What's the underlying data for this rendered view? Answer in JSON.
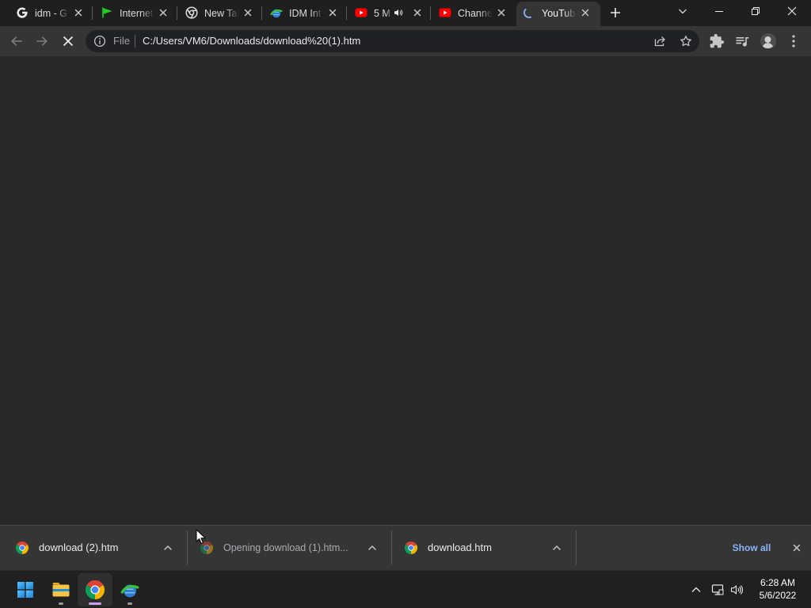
{
  "browser": {
    "tabs": [
      {
        "title": "idm - G",
        "icon": "google-icon"
      },
      {
        "title": "Internet",
        "icon": "green-flag-icon"
      },
      {
        "title": "New Tab",
        "icon": "chrome-icon"
      },
      {
        "title": "IDM Int",
        "icon": "idm-icon"
      },
      {
        "title": "5 M",
        "icon": "youtube-icon",
        "audio_playing": true
      },
      {
        "title": "Channe",
        "icon": "youtube-icon"
      },
      {
        "title": "YouTub",
        "icon": "loading-spinner-icon",
        "active": true
      }
    ],
    "toolbar": {
      "scheme_label": "File",
      "url": "C:/Users/VM6/Downloads/download%20(1).htm",
      "page_loading": true
    }
  },
  "download_shelf": {
    "items": [
      {
        "filename": "download (2).htm",
        "icon": "chrome-file-icon"
      },
      {
        "filename": "Opening download (1).htm...",
        "icon": "chrome-file-icon",
        "dimmed": true
      },
      {
        "filename": "download.htm",
        "icon": "chrome-file-icon"
      }
    ],
    "show_all_label": "Show all"
  },
  "taskbar": {
    "pinned_apps": [
      {
        "icon": "windows-start-icon"
      },
      {
        "icon": "file-explorer-icon",
        "running": true
      },
      {
        "icon": "chrome-icon",
        "running": true,
        "active": true
      },
      {
        "icon": "idm-icon",
        "running": true
      }
    ],
    "tray_icons": [
      "chevron-up-icon",
      "network-icon",
      "speaker-icon"
    ],
    "clock": {
      "time": "6:28 AM",
      "date": "5/6/2022"
    }
  },
  "colors": {
    "tab_strip": "#1f1f1f",
    "toolbar": "#353535",
    "omnibox": "#202124",
    "page": "#292929",
    "link_accent": "#8ab4f8",
    "taskbar": "#202020",
    "taskbar_active_indicator": "#c9a1e8"
  }
}
